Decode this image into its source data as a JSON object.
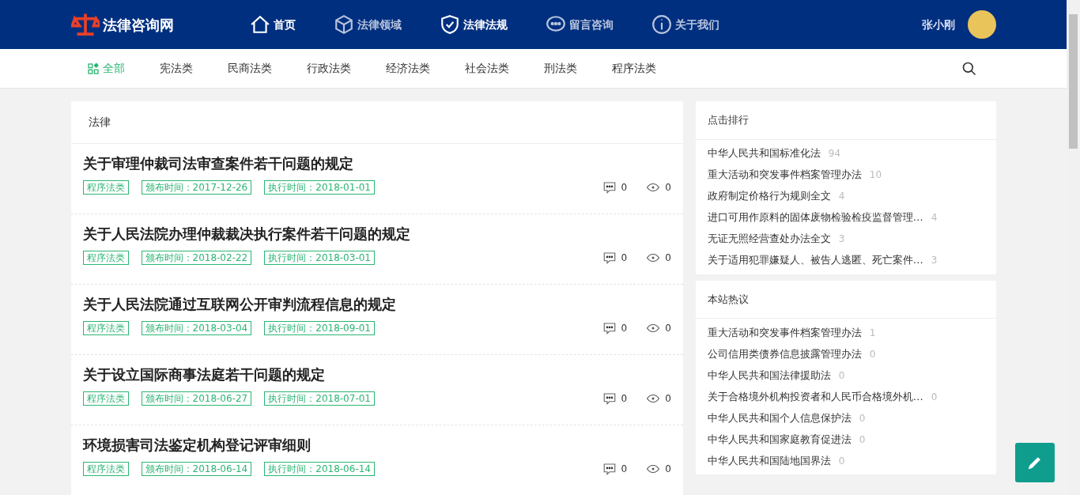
{
  "header": {
    "logo_text": "法律咨询网",
    "nav": [
      {
        "label": "首页",
        "selected": true
      },
      {
        "label": "法律领域",
        "selected": false
      },
      {
        "label": "法律法规",
        "selected": true
      },
      {
        "label": "留言咨询",
        "selected": false
      },
      {
        "label": "关于我们",
        "selected": false
      }
    ],
    "user": {
      "name": "张小刚"
    }
  },
  "categories": [
    {
      "label": "全部",
      "selected": true
    },
    {
      "label": "宪法类",
      "selected": false
    },
    {
      "label": "民商法类",
      "selected": false
    },
    {
      "label": "行政法类",
      "selected": false
    },
    {
      "label": "经济法类",
      "selected": false
    },
    {
      "label": "社会法类",
      "selected": false
    },
    {
      "label": "刑法类",
      "selected": false
    },
    {
      "label": "程序法类",
      "selected": false
    }
  ],
  "main": {
    "title": "法律",
    "articles": [
      {
        "title": "关于审理仲裁司法审查案件若干问题的规定",
        "tags": [
          "程序法类",
          "颁布时间：2017-12-26",
          "执行时间：2018-01-01"
        ],
        "comments": "0",
        "views": "0"
      },
      {
        "title": "关于人民法院办理仲裁裁决执行案件若干问题的规定",
        "tags": [
          "程序法类",
          "颁布时间：2018-02-22",
          "执行时间：2018-03-01"
        ],
        "comments": "0",
        "views": "0"
      },
      {
        "title": "关于人民法院通过互联网公开审判流程信息的规定",
        "tags": [
          "程序法类",
          "颁布时间：2018-03-04",
          "执行时间：2018-09-01"
        ],
        "comments": "0",
        "views": "0"
      },
      {
        "title": "关于设立国际商事法庭若干问题的规定",
        "tags": [
          "程序法类",
          "颁布时间：2018-06-27",
          "执行时间：2018-07-01"
        ],
        "comments": "0",
        "views": "0"
      },
      {
        "title": "环境损害司法鉴定机构登记评审细则",
        "tags": [
          "程序法类",
          "颁布时间：2018-06-14",
          "执行时间：2018-06-14"
        ],
        "comments": "0",
        "views": "0"
      }
    ]
  },
  "sidebar": [
    {
      "title": "点击排行",
      "items": [
        {
          "label": "中华人民共和国标准化法",
          "count": "94"
        },
        {
          "label": "重大活动和突发事件档案管理办法",
          "count": "10"
        },
        {
          "label": "政府制定价格行为规则全文",
          "count": "4"
        },
        {
          "label": "进口可用作原料的固体废物检验检疫监督管理…",
          "count": "4"
        },
        {
          "label": "无证无照经营查处办法全文",
          "count": "3"
        },
        {
          "label": "关于适用犯罪嫌疑人、被告人逃匿、死亡案件…",
          "count": "3"
        }
      ]
    },
    {
      "title": "本站热议",
      "items": [
        {
          "label": "重大活动和突发事件档案管理办法",
          "count": "1"
        },
        {
          "label": "公司信用类债券信息披露管理办法",
          "count": "0"
        },
        {
          "label": "中华人民共和国法律援助法",
          "count": "0"
        },
        {
          "label": "关于合格境外机构投资者和人民币合格境外机…",
          "count": "0"
        },
        {
          "label": "中华人民共和国个人信息保护法",
          "count": "0"
        },
        {
          "label": "中华人民共和国家庭教育促进法",
          "count": "0"
        },
        {
          "label": "中华人民共和国陆地国界法",
          "count": "0"
        }
      ]
    }
  ]
}
